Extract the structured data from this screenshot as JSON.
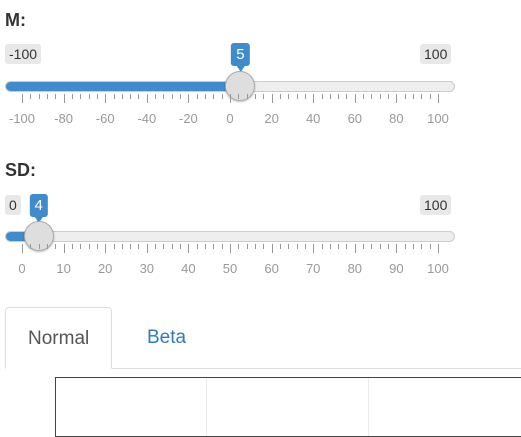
{
  "sliders": [
    {
      "label": "M:",
      "min": -100,
      "max": 100,
      "value": 5,
      "min_label": "-100",
      "max_label": "100",
      "value_label": "5",
      "tick_labels": [
        "-100",
        "-80",
        "-60",
        "-40",
        "-20",
        "0",
        "20",
        "40",
        "60",
        "80",
        "100"
      ]
    },
    {
      "label": "SD:",
      "min": 0,
      "max": 100,
      "value": 4,
      "min_label": "0",
      "max_label": "100",
      "value_label": "4",
      "tick_labels": [
        "0",
        "10",
        "20",
        "30",
        "40",
        "50",
        "60",
        "70",
        "80",
        "90",
        "100"
      ]
    }
  ],
  "tabs": [
    {
      "label": "Normal",
      "active": true
    },
    {
      "label": "Beta",
      "active": false
    }
  ],
  "colors": {
    "accent": "#428bca",
    "link": "#337ab7"
  }
}
